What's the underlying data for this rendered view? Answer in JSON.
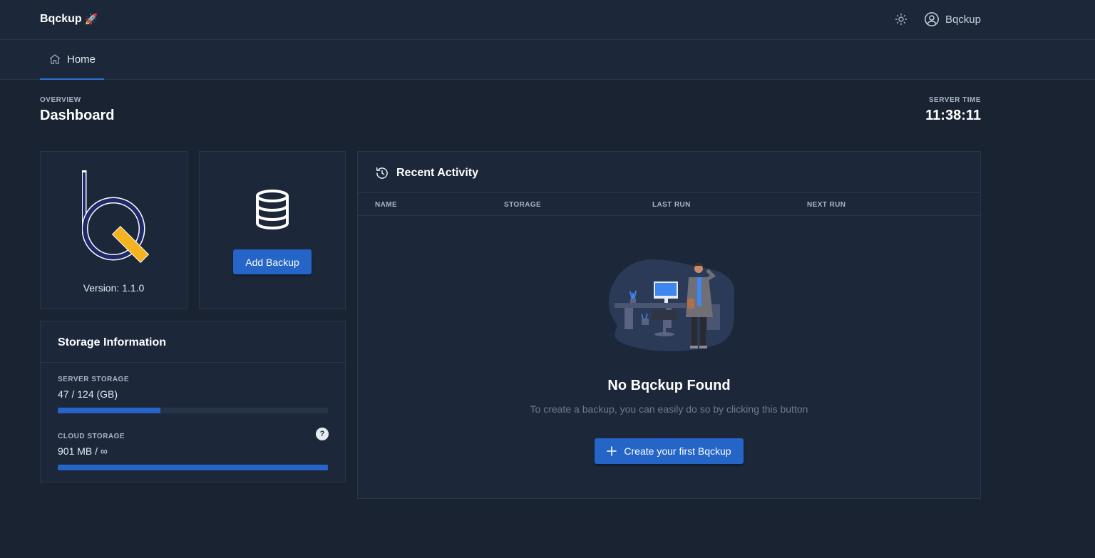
{
  "app": {
    "brand": "Bqckup",
    "brand_emoji": "🚀"
  },
  "topbar": {
    "theme_icon": "sun-icon",
    "user_icon": "user-circle-icon",
    "user_label": "Bqckup"
  },
  "nav": {
    "tabs": [
      {
        "label": "Home",
        "icon": "home-icon",
        "active": true
      }
    ]
  },
  "header": {
    "overline": "OVERVIEW",
    "title": "Dashboard",
    "server_time_label": "SERVER TIME",
    "server_time": "11:38:11"
  },
  "logo_card": {
    "version": "Version: 1.1.0"
  },
  "add_card": {
    "icon": "database-icon",
    "button_label": "Add Backup"
  },
  "storage": {
    "title": "Storage Information",
    "server": {
      "label": "SERVER STORAGE",
      "value": "47 / 124 (GB)",
      "fraction": 0.379
    },
    "cloud": {
      "label": "CLOUD STORAGE",
      "value": "901 MB / ∞",
      "fraction": 1.0,
      "help": "?"
    }
  },
  "activity": {
    "title": "Recent Activity",
    "icon": "history-icon",
    "columns": [
      "NAME",
      "STORAGE",
      "LAST RUN",
      "NEXT RUN"
    ],
    "empty_title": "No Bqckup Found",
    "empty_subtitle": "To create a backup, you can easily do so by clicking this button",
    "create_button": "Create your first Bqckup"
  },
  "colors": {
    "background": "#1a2332",
    "card": "#1c273a",
    "primary": "#2465c7",
    "logo_navy": "#1e2a6b",
    "logo_yellow": "#f5b41f"
  }
}
